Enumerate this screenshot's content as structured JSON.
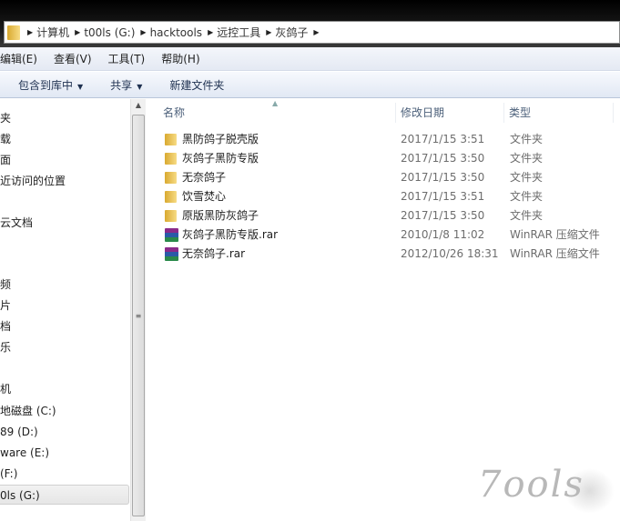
{
  "address": {
    "crumbs": [
      "计算机",
      "t00ls (G:)",
      "hacktools",
      "远控工具",
      "灰鸽子"
    ]
  },
  "menu": [
    "编辑(E)",
    "查看(V)",
    "工具(T)",
    "帮助(H)"
  ],
  "toolbar": {
    "include": "包含到库中",
    "share": "共享",
    "new_folder": "新建文件夹"
  },
  "sidebar": {
    "items": [
      "夹",
      "载",
      "面",
      "近访问的位置",
      "云文档",
      "频",
      "片",
      "档",
      "乐",
      "机",
      "地磁盘 (C:)",
      "89 (D:)",
      "ware (E:)",
      "(F:)",
      "0ls (G:)"
    ]
  },
  "columns": {
    "name": "名称",
    "date": "修改日期",
    "type": "类型"
  },
  "files": [
    {
      "name": "黑防鸽子脱壳版",
      "date": "2017/1/15 3:51",
      "type": "文件夹",
      "icon": "folder"
    },
    {
      "name": "灰鸽子黑防专版",
      "date": "2017/1/15 3:50",
      "type": "文件夹",
      "icon": "folder"
    },
    {
      "name": "无奈鸽子",
      "date": "2017/1/15 3:50",
      "type": "文件夹",
      "icon": "folder"
    },
    {
      "name": "饮雪焚心",
      "date": "2017/1/15 3:51",
      "type": "文件夹",
      "icon": "folder"
    },
    {
      "name": "原版黑防灰鸽子",
      "date": "2017/1/15 3:50",
      "type": "文件夹",
      "icon": "folder"
    },
    {
      "name": "灰鸽子黑防专版.rar",
      "date": "2010/1/8 11:02",
      "type": "WinRAR 压缩文件",
      "icon": "winrar"
    },
    {
      "name": "无奈鸽子.rar",
      "date": "2012/10/26 18:31",
      "type": "WinRAR 压缩文件",
      "icon": "winrar"
    }
  ],
  "watermark": "7ools"
}
